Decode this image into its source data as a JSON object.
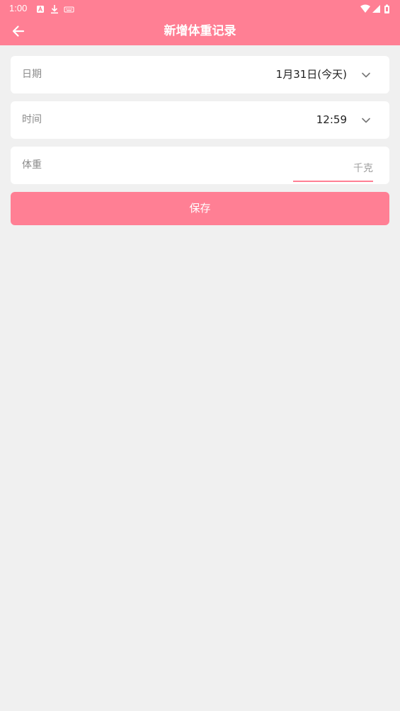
{
  "status_bar": {
    "time": "1:00",
    "left_icons": [
      "a-icon",
      "download-icon",
      "keyboard-icon"
    ],
    "right_icons": [
      "wifi-icon",
      "signal-icon",
      "battery-icon"
    ]
  },
  "app_bar": {
    "title": "新增体重记录",
    "back_icon": "arrow-left-icon"
  },
  "form": {
    "date": {
      "label": "日期",
      "value": "1月31日(今天)"
    },
    "time": {
      "label": "时间",
      "value": "12:59"
    },
    "weight": {
      "label": "体重",
      "placeholder": "千克",
      "value": ""
    }
  },
  "save_label": "保存",
  "colors": {
    "accent": "#ff7f94",
    "background": "#f0f0f0",
    "card": "#ffffff"
  }
}
